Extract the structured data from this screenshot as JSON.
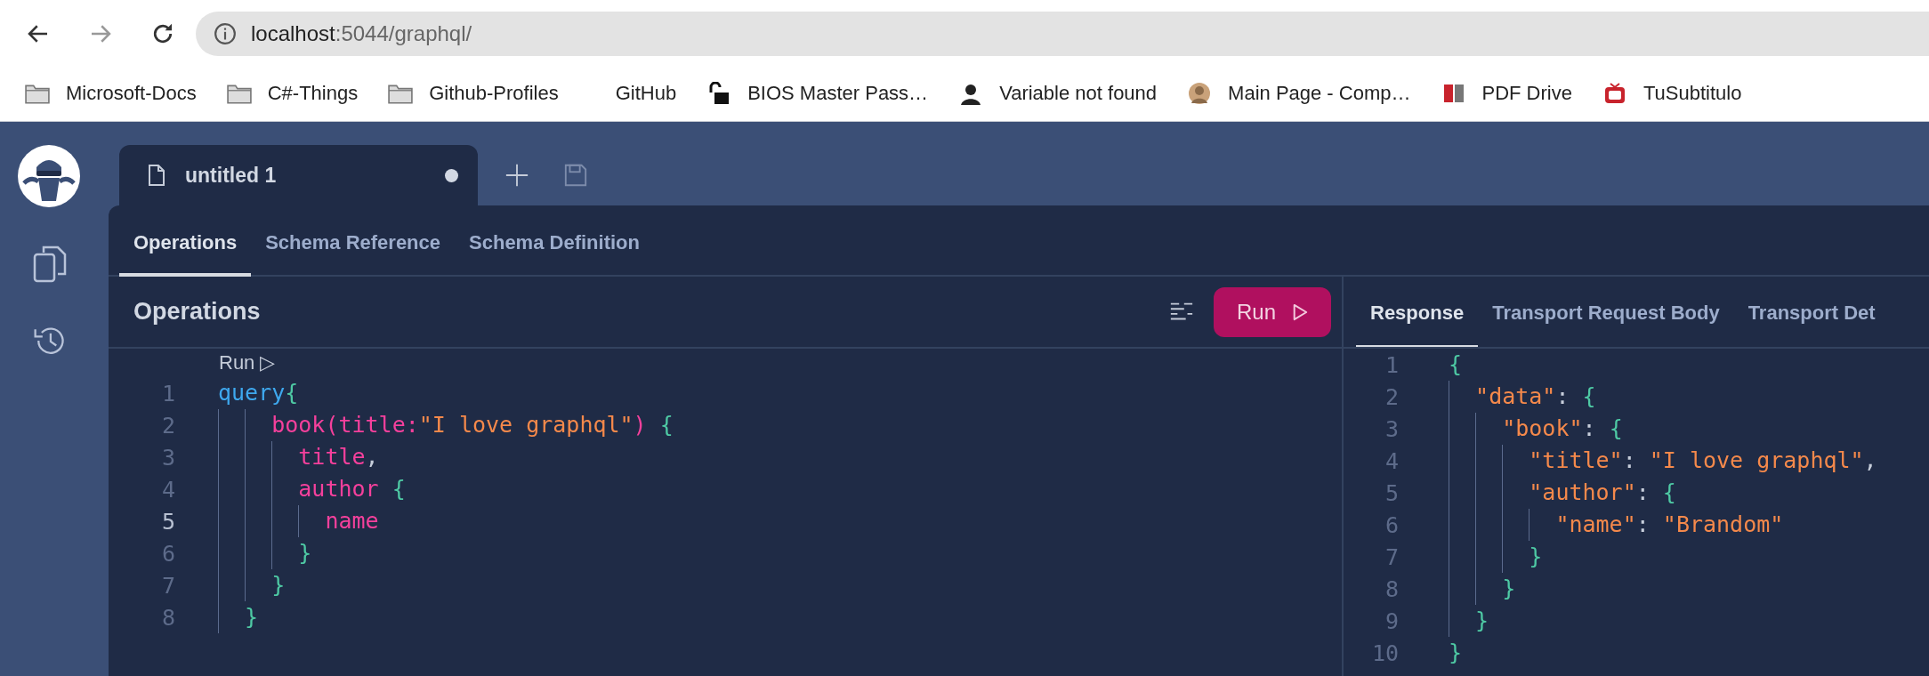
{
  "browser": {
    "address": {
      "host": "localhost",
      "path": ":5044/graphql/"
    },
    "bookmarks": [
      {
        "kind": "folder",
        "label": "Microsoft-Docs"
      },
      {
        "kind": "folder",
        "label": "C#-Things"
      },
      {
        "kind": "folder",
        "label": "Github-Profiles"
      },
      {
        "kind": "blank",
        "label": "GitHub"
      },
      {
        "kind": "lock",
        "label": "BIOS Master Pass…"
      },
      {
        "kind": "portrait",
        "label": "Variable not found"
      },
      {
        "kind": "avatar",
        "label": "Main Page - Comp…"
      },
      {
        "kind": "pdf",
        "label": "PDF Drive"
      },
      {
        "kind": "tv",
        "label": "TuSubtitulo"
      }
    ]
  },
  "document_tabs": [
    {
      "title": "untitled 1",
      "modified": true,
      "selected": true
    }
  ],
  "section_tabs": [
    {
      "label": "Operations",
      "selected": true
    },
    {
      "label": "Schema Reference",
      "selected": false
    },
    {
      "label": "Schema Definition",
      "selected": false
    }
  ],
  "operations": {
    "title": "Operations",
    "run_button": "Run",
    "code_lens": "Run ▷",
    "lines": [
      {
        "number": "1",
        "current": false,
        "tokens": [
          {
            "kind": "keyword",
            "text": "query"
          },
          {
            "kind": "brace",
            "text": "{"
          }
        ]
      },
      {
        "number": "2",
        "current": false,
        "tokens": [
          {
            "kind": "field",
            "text": "    book(title:"
          },
          {
            "kind": "string",
            "text": "\"I love graphql\""
          },
          {
            "kind": "field",
            "text": ")"
          },
          {
            "kind": "brace",
            "text": " {"
          }
        ]
      },
      {
        "number": "3",
        "current": false,
        "tokens": [
          {
            "kind": "field",
            "text": "      title"
          },
          {
            "kind": "punct",
            "text": ","
          }
        ]
      },
      {
        "number": "4",
        "current": false,
        "tokens": [
          {
            "kind": "field",
            "text": "      author"
          },
          {
            "kind": "brace",
            "text": " {"
          }
        ]
      },
      {
        "number": "5",
        "current": true,
        "tokens": [
          {
            "kind": "field",
            "text": "        name"
          }
        ]
      },
      {
        "number": "6",
        "current": false,
        "tokens": [
          {
            "kind": "brace",
            "text": "      }"
          }
        ]
      },
      {
        "number": "7",
        "current": false,
        "tokens": [
          {
            "kind": "brace",
            "text": "    }"
          }
        ]
      },
      {
        "number": "8",
        "current": false,
        "tokens": [
          {
            "kind": "brace",
            "text": "  }"
          }
        ]
      }
    ]
  },
  "response": {
    "tabs": [
      {
        "label": "Response",
        "selected": true
      },
      {
        "label": "Transport Request Body",
        "selected": false
      },
      {
        "label": "Transport Det",
        "selected": false
      }
    ],
    "lines": [
      {
        "number": "1",
        "tokens": [
          {
            "kind": "brace",
            "text": "{"
          }
        ]
      },
      {
        "number": "2",
        "tokens": [
          {
            "kind": "string",
            "text": "  \"data\""
          },
          {
            "kind": "punct",
            "text": ": "
          },
          {
            "kind": "brace",
            "text": "{"
          }
        ]
      },
      {
        "number": "3",
        "tokens": [
          {
            "kind": "string",
            "text": "    \"book\""
          },
          {
            "kind": "punct",
            "text": ": "
          },
          {
            "kind": "brace",
            "text": "{"
          }
        ]
      },
      {
        "number": "4",
        "tokens": [
          {
            "kind": "string",
            "text": "      \"title\""
          },
          {
            "kind": "punct",
            "text": ": "
          },
          {
            "kind": "string",
            "text": "\"I love graphql\""
          },
          {
            "kind": "punct",
            "text": ","
          }
        ]
      },
      {
        "number": "5",
        "tokens": [
          {
            "kind": "string",
            "text": "      \"author\""
          },
          {
            "kind": "punct",
            "text": ": "
          },
          {
            "kind": "brace",
            "text": "{"
          }
        ]
      },
      {
        "number": "6",
        "tokens": [
          {
            "kind": "string",
            "text": "        \"name\""
          },
          {
            "kind": "punct",
            "text": ": "
          },
          {
            "kind": "string",
            "text": "\"Brandom\""
          }
        ]
      },
      {
        "number": "7",
        "tokens": [
          {
            "kind": "brace",
            "text": "      }"
          }
        ]
      },
      {
        "number": "8",
        "tokens": [
          {
            "kind": "brace",
            "text": "    }"
          }
        ]
      },
      {
        "number": "9",
        "tokens": [
          {
            "kind": "brace",
            "text": "  }"
          }
        ]
      },
      {
        "number": "10",
        "tokens": [
          {
            "kind": "brace",
            "text": "}"
          }
        ]
      }
    ]
  }
}
